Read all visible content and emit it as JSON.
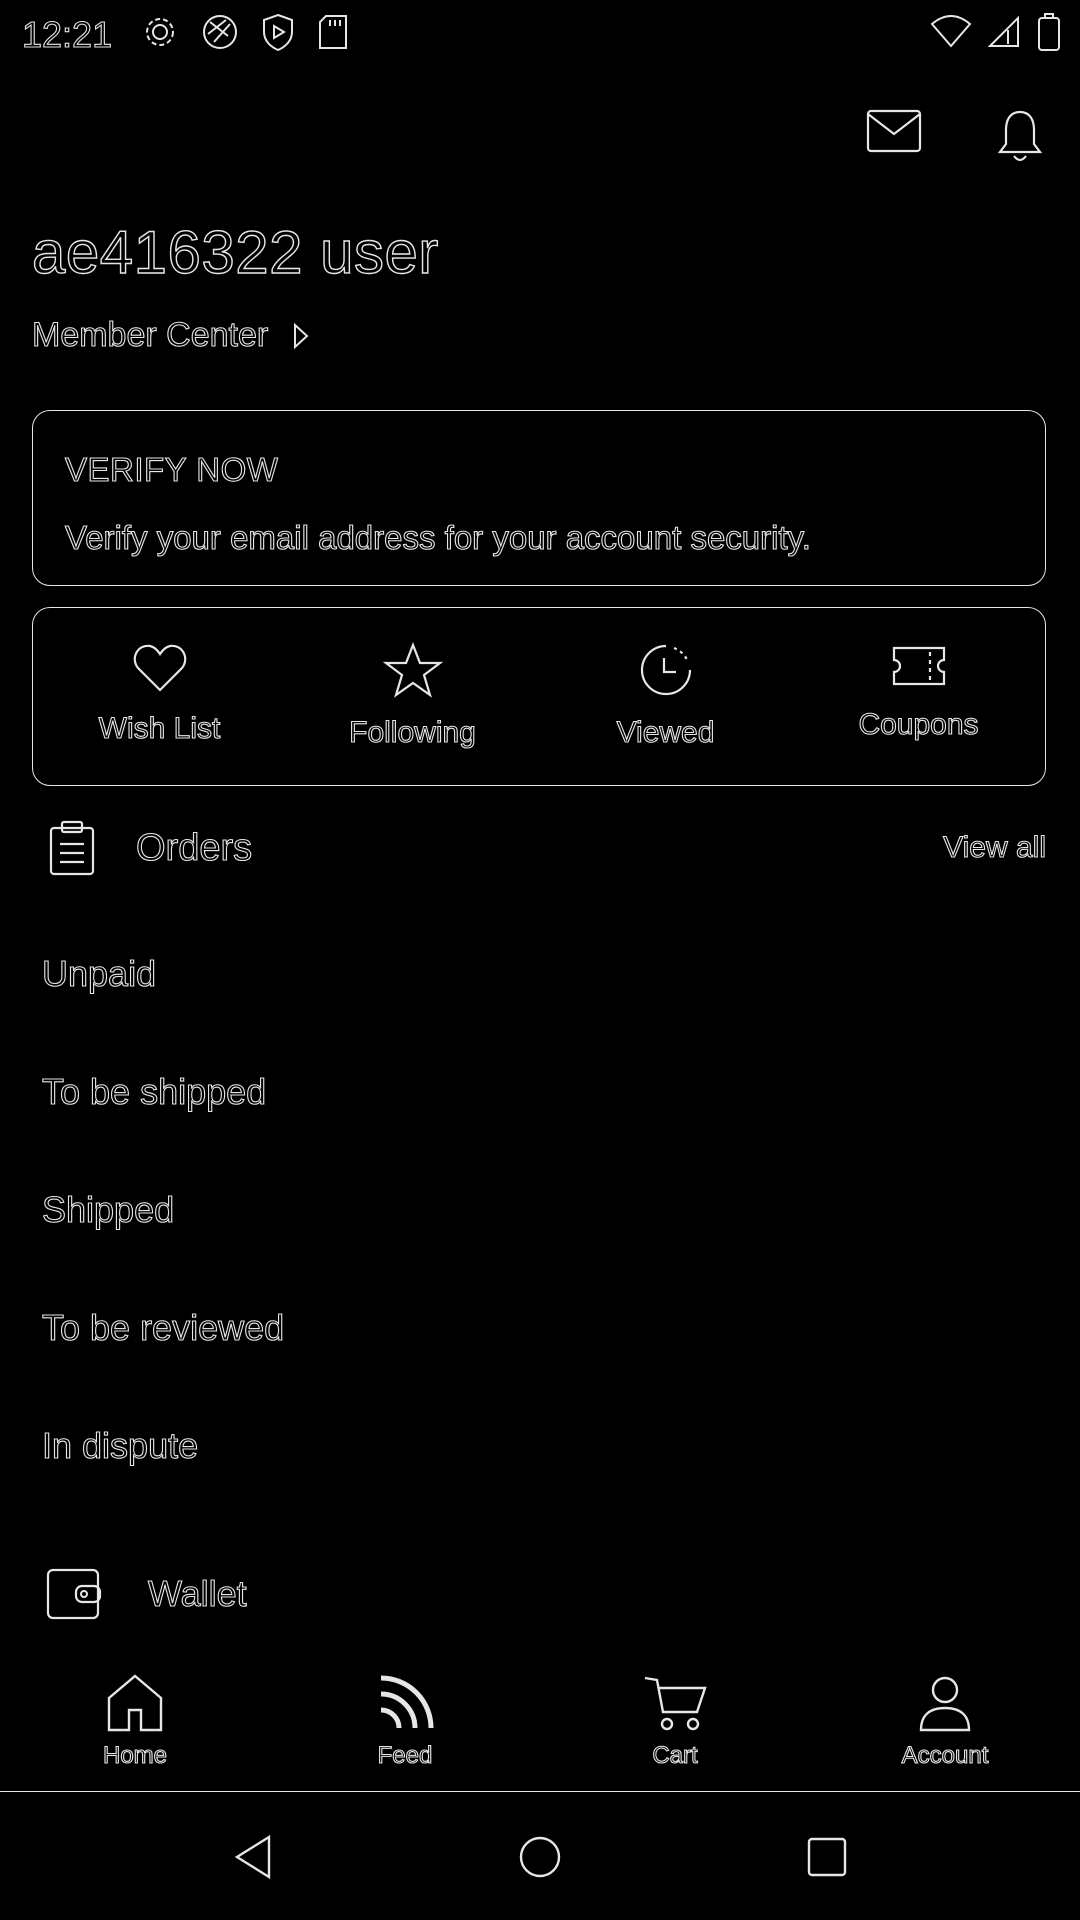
{
  "status_bar": {
    "time": "12:21",
    "left_icons": [
      "gear-icon",
      "aperture-icon",
      "shield-play-icon",
      "sd-card-icon"
    ],
    "right_icons": [
      "wifi-icon",
      "signal-icon",
      "battery-icon"
    ]
  },
  "header": {
    "icons": [
      "mail-icon",
      "bell-icon"
    ],
    "user_name": "ae416322 user",
    "member_center": "Member Center"
  },
  "verify_card": {
    "title": "VERIFY NOW",
    "description": "Verify your email address for your account security."
  },
  "quick_links": [
    {
      "label": "Wish List",
      "icon": "heart-icon"
    },
    {
      "label": "Following",
      "icon": "star-icon"
    },
    {
      "label": "Viewed",
      "icon": "history-icon"
    },
    {
      "label": "Coupons",
      "icon": "ticket-icon"
    }
  ],
  "orders": {
    "title": "Orders",
    "view_all": "View all",
    "items": [
      "Unpaid",
      "To be shipped",
      "Shipped",
      "To be reviewed",
      "In dispute"
    ]
  },
  "wallet": {
    "label": "Wallet"
  },
  "bottom_nav": [
    {
      "label": "Home",
      "icon": "home-icon"
    },
    {
      "label": "Feed",
      "icon": "feed-icon"
    },
    {
      "label": "Cart",
      "icon": "cart-icon"
    },
    {
      "label": "Account",
      "icon": "account-icon"
    }
  ],
  "system_nav": [
    "back-icon",
    "home-circle-icon",
    "recents-icon"
  ],
  "colors": {
    "background": "#000000",
    "outline": "#e6e6e6"
  }
}
